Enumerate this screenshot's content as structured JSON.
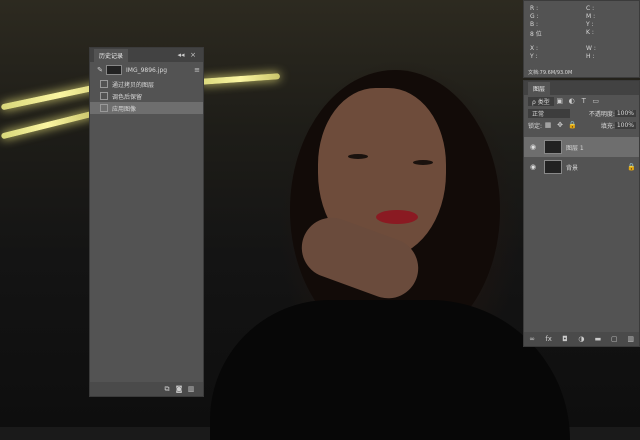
{
  "history": {
    "title": "历史记录",
    "snapshot": "IMG_9896.jpg",
    "items": [
      "通过拷贝的图层",
      "调色后保留",
      "应用图像"
    ],
    "collapse": "◂◂",
    "close": "×",
    "menu": "≡"
  },
  "info": {
    "labels1": [
      "R :",
      "G :",
      "B :"
    ],
    "labels2": [
      "C :",
      "M :",
      "Y :",
      "K :"
    ],
    "bit": "8 位",
    "xy": [
      "X :",
      "Y :"
    ],
    "wh": [
      "W :",
      "H :"
    ],
    "doc": "文档:79.6M/93.0M"
  },
  "layers": {
    "title": "图层",
    "filter": "ρ 类型",
    "mode": "正常",
    "opacity_label": "不透明度:",
    "opacity": "100%",
    "lock_label": "锁定:",
    "fill_label": "填充:",
    "fill": "100%",
    "rows": [
      {
        "name": "图层 1",
        "selected": true
      },
      {
        "name": "背景",
        "selected": false
      }
    ]
  },
  "colors": {
    "accent": "#d0cb6c",
    "panel": "#535353",
    "lips": "#8a1a22"
  }
}
